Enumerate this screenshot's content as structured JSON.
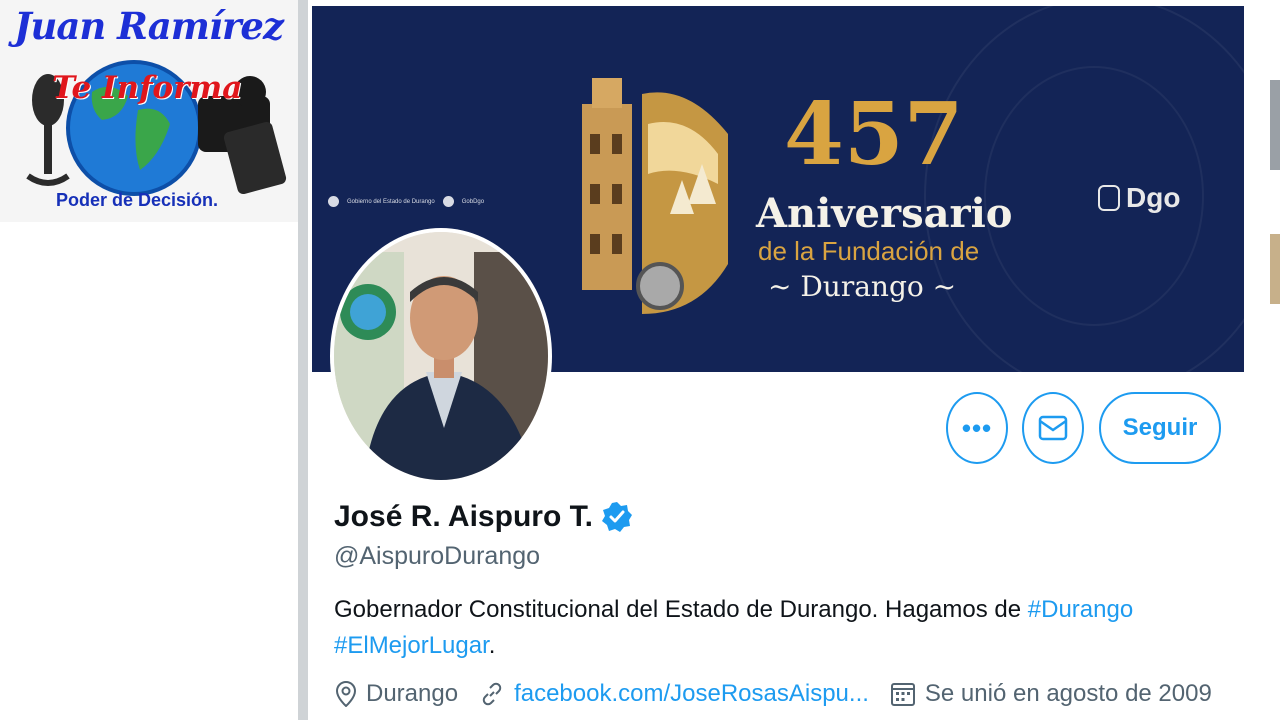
{
  "overlay": {
    "title": "Juan Ramírez",
    "subtitle": "Te Informa",
    "tagline": "Poder de Decisión."
  },
  "banner": {
    "social": [
      "Gobierno del Estado de Durango",
      "GobDgo"
    ],
    "number": "457",
    "heading": "Aniversario",
    "line2": "de la Fundación de",
    "line3": "~ Durango ~",
    "brand": "Dgo"
  },
  "profile": {
    "name": "José R. Aispuro T.",
    "handle": "@AispuroDurango",
    "bio_text": "Gobernador Constitucional del Estado de Durango. Hagamos de ",
    "bio_tag1": "#Durango",
    "bio_tag2": "#ElMejorLugar",
    "bio_end": ".",
    "location": "Durango",
    "website": "facebook.com/JoseRosasAispu...",
    "joined": "Se unió en agosto de 2009"
  },
  "actions": {
    "more": "•••",
    "follow": "Seguir"
  },
  "colors": {
    "accent": "#1d9bf0",
    "banner": "#132456",
    "gold": "#d9a441"
  },
  "icons": [
    "more-icon",
    "mail-icon",
    "verified-icon",
    "location-icon",
    "link-icon",
    "calendar-icon"
  ]
}
